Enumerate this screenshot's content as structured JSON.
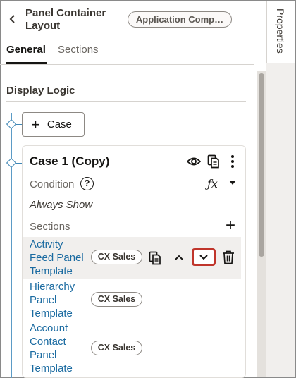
{
  "header": {
    "back_icon": "chevron-left-icon",
    "title": "Panel Container Layout",
    "component_badge": "Application Comp…"
  },
  "tabs": [
    {
      "label": "General",
      "selected": true
    },
    {
      "label": "Sections",
      "selected": false
    }
  ],
  "side_tab": {
    "label": "Properties"
  },
  "display_logic": {
    "heading": "Display Logic",
    "add_case_label": "Case"
  },
  "case": {
    "title": "Case 1 (Copy)",
    "condition_label": "Condition",
    "condition_help": "?",
    "fx_label": "ƒx",
    "condition_value": "Always Show",
    "sections_label": "Sections",
    "sections": [
      {
        "lines": [
          "Activity",
          "Feed Panel",
          "Template"
        ],
        "badge": "CX Sales",
        "selected": true
      },
      {
        "lines": [
          "Hierarchy",
          "Panel",
          "Template"
        ],
        "badge": "CX Sales",
        "selected": false
      },
      {
        "lines": [
          "Account",
          "Contact",
          "Panel",
          "Template"
        ],
        "badge": "CX Sales",
        "selected": false
      }
    ]
  },
  "colors": {
    "link": "#1b6ba1",
    "tree_accent": "#3f86b5",
    "highlight_border": "#c0352b",
    "row_highlight": "#f1efed"
  }
}
